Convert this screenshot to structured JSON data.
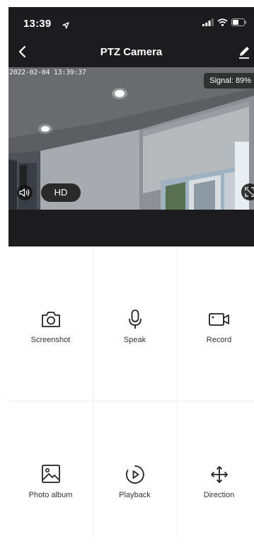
{
  "status_bar": {
    "time": "13:39"
  },
  "nav": {
    "title": "PTZ Camera",
    "back_icon": "chevron-left-icon",
    "edit_icon": "pencil-icon"
  },
  "video": {
    "timestamp": "2022-02-04 13:39:37",
    "signal": "Signal: 89%",
    "quality": "HD"
  },
  "actions": [
    {
      "label": "Screenshot",
      "icon": "camera-icon"
    },
    {
      "label": "Speak",
      "icon": "microphone-icon"
    },
    {
      "label": "Record",
      "icon": "video-camera-icon"
    },
    {
      "label": "Photo album",
      "icon": "photo-icon"
    },
    {
      "label": "Playback",
      "icon": "play-circle-icon"
    },
    {
      "label": "Direction",
      "icon": "move-arrows-icon"
    }
  ],
  "colors": {
    "header_bg": "#1c1c1e",
    "grid_line": "#ededed",
    "text": "#333333"
  }
}
